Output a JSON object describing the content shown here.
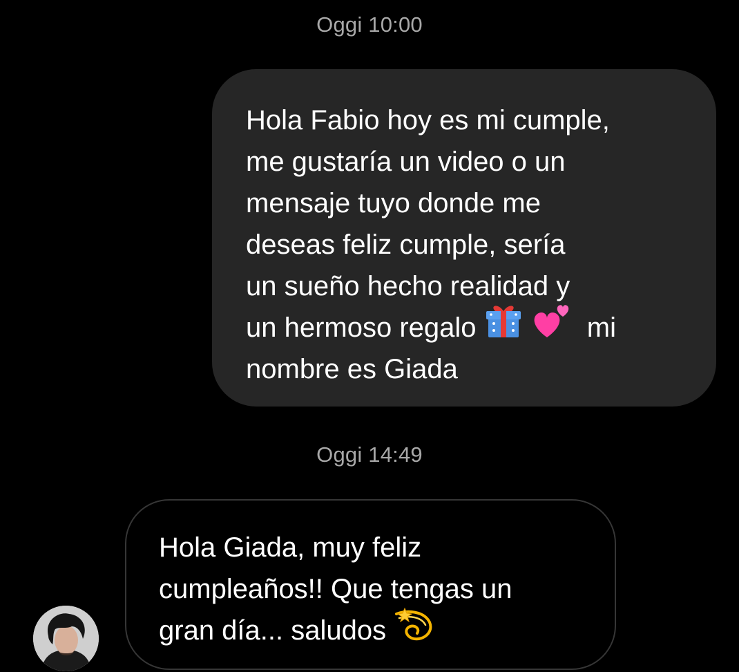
{
  "conversation": {
    "messages": [
      {
        "timestamp": "Oggi 10:00",
        "direction": "outgoing",
        "lines": [
          "Hola Fabio hoy es mi cumple,",
          "me gustaría un video o un",
          "mensaje tuyo donde me",
          "deseas feliz cumple, sería",
          "un sueño hecho realidad y",
          "un hermoso regalo",
          "mi",
          "nombre es Giada"
        ],
        "emojis": [
          "gift-emoji",
          "two-hearts-emoji"
        ]
      },
      {
        "timestamp": "Oggi 14:49",
        "direction": "incoming",
        "lines": [
          "Hola Giada, muy feliz",
          "cumpleaños!! Que tengas un",
          "gran día... saludos"
        ],
        "emojis": [
          "dizzy-emoji"
        ]
      }
    ]
  },
  "colors": {
    "background": "#000000",
    "outgoing_bubble": "#262626",
    "incoming_bubble_border": "#363636",
    "timestamp_text": "#a8a8a8",
    "message_text": "#ffffff"
  }
}
